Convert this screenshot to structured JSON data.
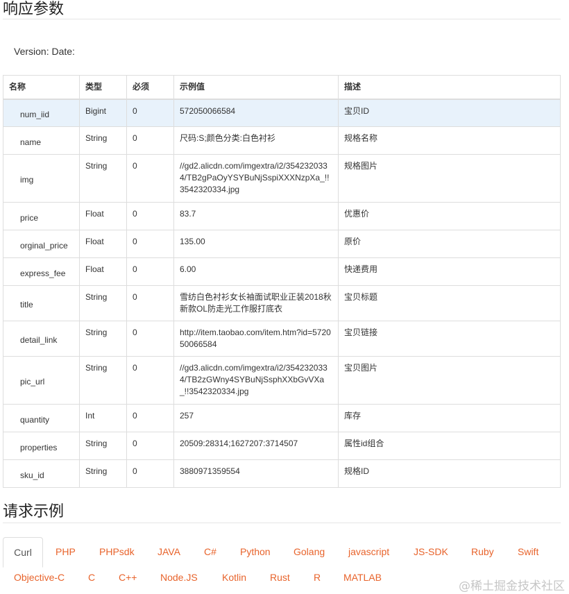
{
  "response_title": "响应参数",
  "version_text": "Version: Date:",
  "table": {
    "headers": [
      "名称",
      "类型",
      "必须",
      "示例值",
      "描述"
    ],
    "rows": [
      {
        "name": "num_iid",
        "type": "Bigint",
        "required": "0",
        "example": "572050066584",
        "desc": "宝贝ID"
      },
      {
        "name": "name",
        "type": "String",
        "required": "0",
        "example": "尺码:S;颜色分类:白色衬衫",
        "desc": "规格名称"
      },
      {
        "name": "img",
        "type": "String",
        "required": "0",
        "example": "//gd2.alicdn.com/imgextra/i2/3542320334/TB2gPaOyYSYBuNjSspiXXXNzpXa_!!3542320334.jpg",
        "desc": "规格图片"
      },
      {
        "name": "price",
        "type": "Float",
        "required": "0",
        "example": "83.7",
        "desc": "优惠价"
      },
      {
        "name": "orginal_price",
        "type": "Float",
        "required": "0",
        "example": "135.00",
        "desc": "原价"
      },
      {
        "name": "express_fee",
        "type": "Float",
        "required": "0",
        "example": "6.00",
        "desc": "快递费用"
      },
      {
        "name": "title",
        "type": "String",
        "required": "0",
        "example": "雪纺白色衬衫女长袖面试职业正装2018秋新款OL防走光工作服打底衣",
        "desc": "宝贝标题"
      },
      {
        "name": "detail_link",
        "type": "String",
        "required": "0",
        "example": "http://item.taobao.com/item.htm?id=572050066584",
        "desc": "宝贝链接"
      },
      {
        "name": "pic_url",
        "type": "String",
        "required": "0",
        "example": "//gd3.alicdn.com/imgextra/i2/3542320334/TB2zGWny4SYBuNjSsphXXbGvVXa_!!3542320334.jpg",
        "desc": "宝贝图片"
      },
      {
        "name": "quantity",
        "type": "Int",
        "required": "0",
        "example": "257",
        "desc": "库存"
      },
      {
        "name": "properties",
        "type": "String",
        "required": "0",
        "example": "20509:28314;1627207:3714507",
        "desc": "属性id组合"
      },
      {
        "name": "sku_id",
        "type": "String",
        "required": "0",
        "example": "3880971359554",
        "desc": "规格ID"
      }
    ]
  },
  "request_title": "请求示例",
  "tabs": [
    "Curl",
    "PHP",
    "PHPsdk",
    "JAVA",
    "C#",
    "Python",
    "Golang",
    "javascript",
    "JS-SDK",
    "Ruby",
    "Swift",
    "Objective-C",
    "C",
    "C++",
    "Node.JS",
    "Kotlin",
    "Rust",
    "R",
    "MATLAB"
  ],
  "active_tab": "Curl",
  "watermark": "@稀土掘金技术社区",
  "colors": {
    "tab_link": "#e8632b",
    "highlight_row": "#e8f2fb"
  }
}
